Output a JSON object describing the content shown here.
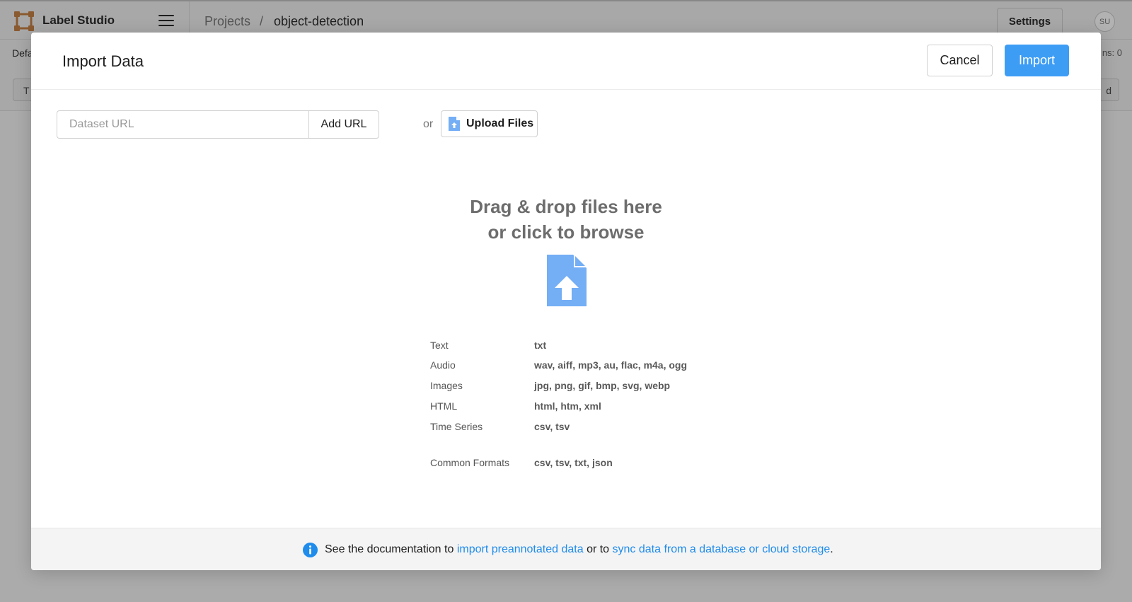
{
  "app": {
    "brand": "Label Studio",
    "breadcrumb": {
      "projects": "Projects",
      "separator": "/",
      "current": "object-detection"
    },
    "settings_label": "Settings",
    "avatar_initials": "SU",
    "subbar": {
      "tab_label": "Defa",
      "annotations_label": "ns: 0",
      "left_button": "T",
      "right_button": "d"
    }
  },
  "modal": {
    "title": "Import Data",
    "cancel_label": "Cancel",
    "import_label": "Import",
    "url_input": {
      "placeholder": "Dataset URL",
      "value": ""
    },
    "add_url_label": "Add URL",
    "or_label": "or",
    "upload_label": "Upload Files",
    "dropzone": {
      "line1": "Drag & drop files here",
      "line2": "or click to browse"
    },
    "formats": [
      {
        "label": "Text",
        "value": "txt"
      },
      {
        "label": "Audio",
        "value": "wav, aiff, mp3, au, flac, m4a, ogg"
      },
      {
        "label": "Images",
        "value": "jpg, png, gif, bmp, svg, webp"
      },
      {
        "label": "HTML",
        "value": "html, htm, xml"
      },
      {
        "label": "Time Series",
        "value": "csv, tsv"
      },
      {
        "label": "Common Formats",
        "value": "csv, tsv, txt, json"
      }
    ],
    "footer": {
      "prefix": "See the documentation to",
      "link1": "import preannotated data",
      "middle": "or to",
      "link2": "sync data from a database or cloud storage",
      "suffix": "."
    }
  },
  "icons": {
    "logo": "label-studio-logo-icon",
    "menu": "hamburger-menu-icon",
    "upload": "file-upload-icon",
    "info": "info-icon"
  },
  "colors": {
    "accent": "#3d9df5",
    "link": "#1f8cec",
    "upload_icon": "#74aef5",
    "logo": "#b36b30"
  }
}
